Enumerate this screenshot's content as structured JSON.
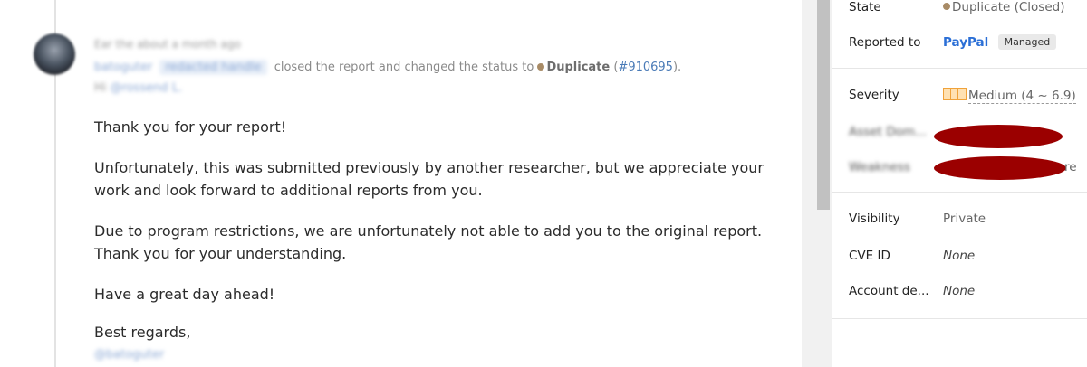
{
  "activity": {
    "time": "Ear the about a month ago",
    "user": "batoguter",
    "user_tag": "redacted handle",
    "action_text": "closed the report and changed the status to",
    "status_label": "Duplicate",
    "duplicate_link": "#910695",
    "open_paren": "(",
    "close_paren": ").",
    "greeting_prefix": "Hi",
    "greeting_name": "@rossend L."
  },
  "message": {
    "p1": "Thank you for your report!",
    "p2": "Unfortunately, this was submitted previously by another researcher, but we appreciate your work and look forward to additional reports from you.",
    "p3": "Due to program restrictions, we are unfortunately not able to add you to the original report. Thank you for your understanding.",
    "p4": "Have a great day ahead!",
    "p5": "Best regards,",
    "signature": "@batoguter"
  },
  "sidebar": {
    "state_label": "State",
    "state_value": "Duplicate (Closed)",
    "reported_to_label": "Reported to",
    "program": "PayPal",
    "managed_badge": "Managed",
    "severity_label": "Severity",
    "severity_value": "Medium (4 ~ 6.9)",
    "asset_label": "Asset Dom...",
    "weakness_label": "Weakness",
    "weakness_tail": "re",
    "visibility_label": "Visibility",
    "visibility_value": "Private",
    "cve_label": "CVE ID",
    "cve_value": "None",
    "account_label": "Account de...",
    "account_value": "None"
  },
  "colors": {
    "accent_link": "#4a7bb7",
    "paypal_blue": "#2b6fd6",
    "redaction": "#9b0000",
    "duplicate_dot": "#a88b66",
    "severity_medium": "#f0a23a"
  }
}
